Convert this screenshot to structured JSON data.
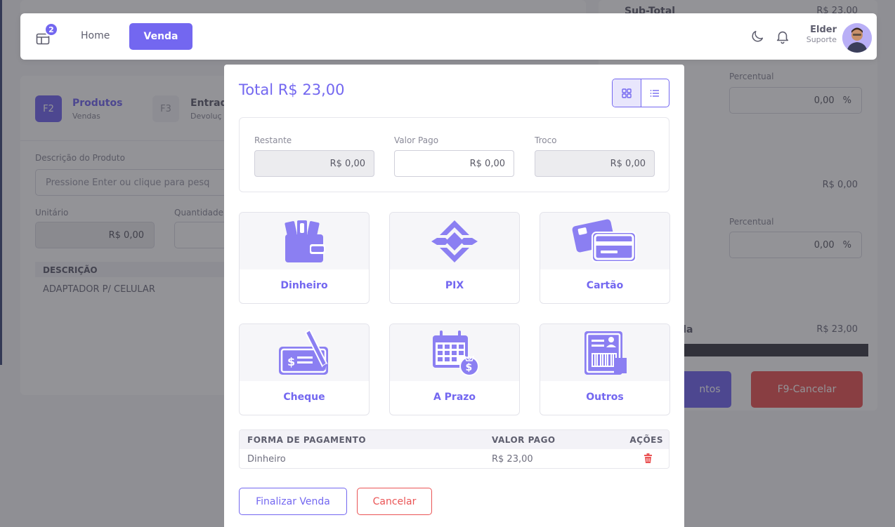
{
  "background": {
    "tabs": [
      {
        "key": "F2",
        "label": "Produtos",
        "sub": "Vendas"
      },
      {
        "key": "F3",
        "label": "Entrad",
        "sub": "Devoluç"
      }
    ],
    "descricao_label": "Descrição do Produto",
    "descricao_placeholder": "Pressione Enter ou clique para pesq",
    "unitario_label": "Unitário",
    "unitario_value": "R$ 0,00",
    "quantidade_label": "Quantidade",
    "table_header": "DESCRIÇÃO",
    "table_item": "ADAPTADOR P/ CELULAR",
    "subtotal_label": "Sub-Total",
    "subtotal_value": "R$ 23,00",
    "percentual_label_1": "Percentual",
    "percentual_value_1": "0,00",
    "percent_sign": "%",
    "mid_value": "R$ 0,00",
    "percentual_label_2": "Percentual",
    "percentual_value_2": "0,00",
    "total_label_partial": "da",
    "total_value": "R$ 23,00",
    "btn_left_partial": "ntos",
    "btn_cancel": "F9-Cancelar"
  },
  "navbar": {
    "badge_count": "2",
    "home": "Home",
    "venda": "Venda",
    "user_name": "Elder",
    "user_role": "Suporte"
  },
  "modal": {
    "title": "Total R$ 23,00",
    "restante_label": "Restante",
    "restante_value": "R$ 0,00",
    "valor_pago_label": "Valor Pago",
    "valor_pago_value": "R$ 0,00",
    "troco_label": "Troco",
    "troco_value": "R$ 0,00",
    "payment_methods": [
      {
        "label": "Dinheiro",
        "icon": "wallet-cash-icon"
      },
      {
        "label": "PIX",
        "icon": "pix-icon"
      },
      {
        "label": "Cartão",
        "icon": "credit-cards-icon"
      },
      {
        "label": "Cheque",
        "icon": "check-pen-icon"
      },
      {
        "label": "A Prazo",
        "icon": "calendar-money-icon"
      },
      {
        "label": "Outros",
        "icon": "document-barcode-icon"
      }
    ],
    "table": {
      "headers": [
        "FORMA DE PAGAMENTO",
        "VALOR PAGO",
        "AÇÕES"
      ],
      "rows": [
        {
          "forma": "Dinheiro",
          "valor": "R$ 23,00"
        }
      ]
    },
    "finalizar": "Finalizar Venda",
    "cancelar": "Cancelar"
  },
  "colors": {
    "primary": "#7367f0",
    "danger": "#ea5455"
  }
}
